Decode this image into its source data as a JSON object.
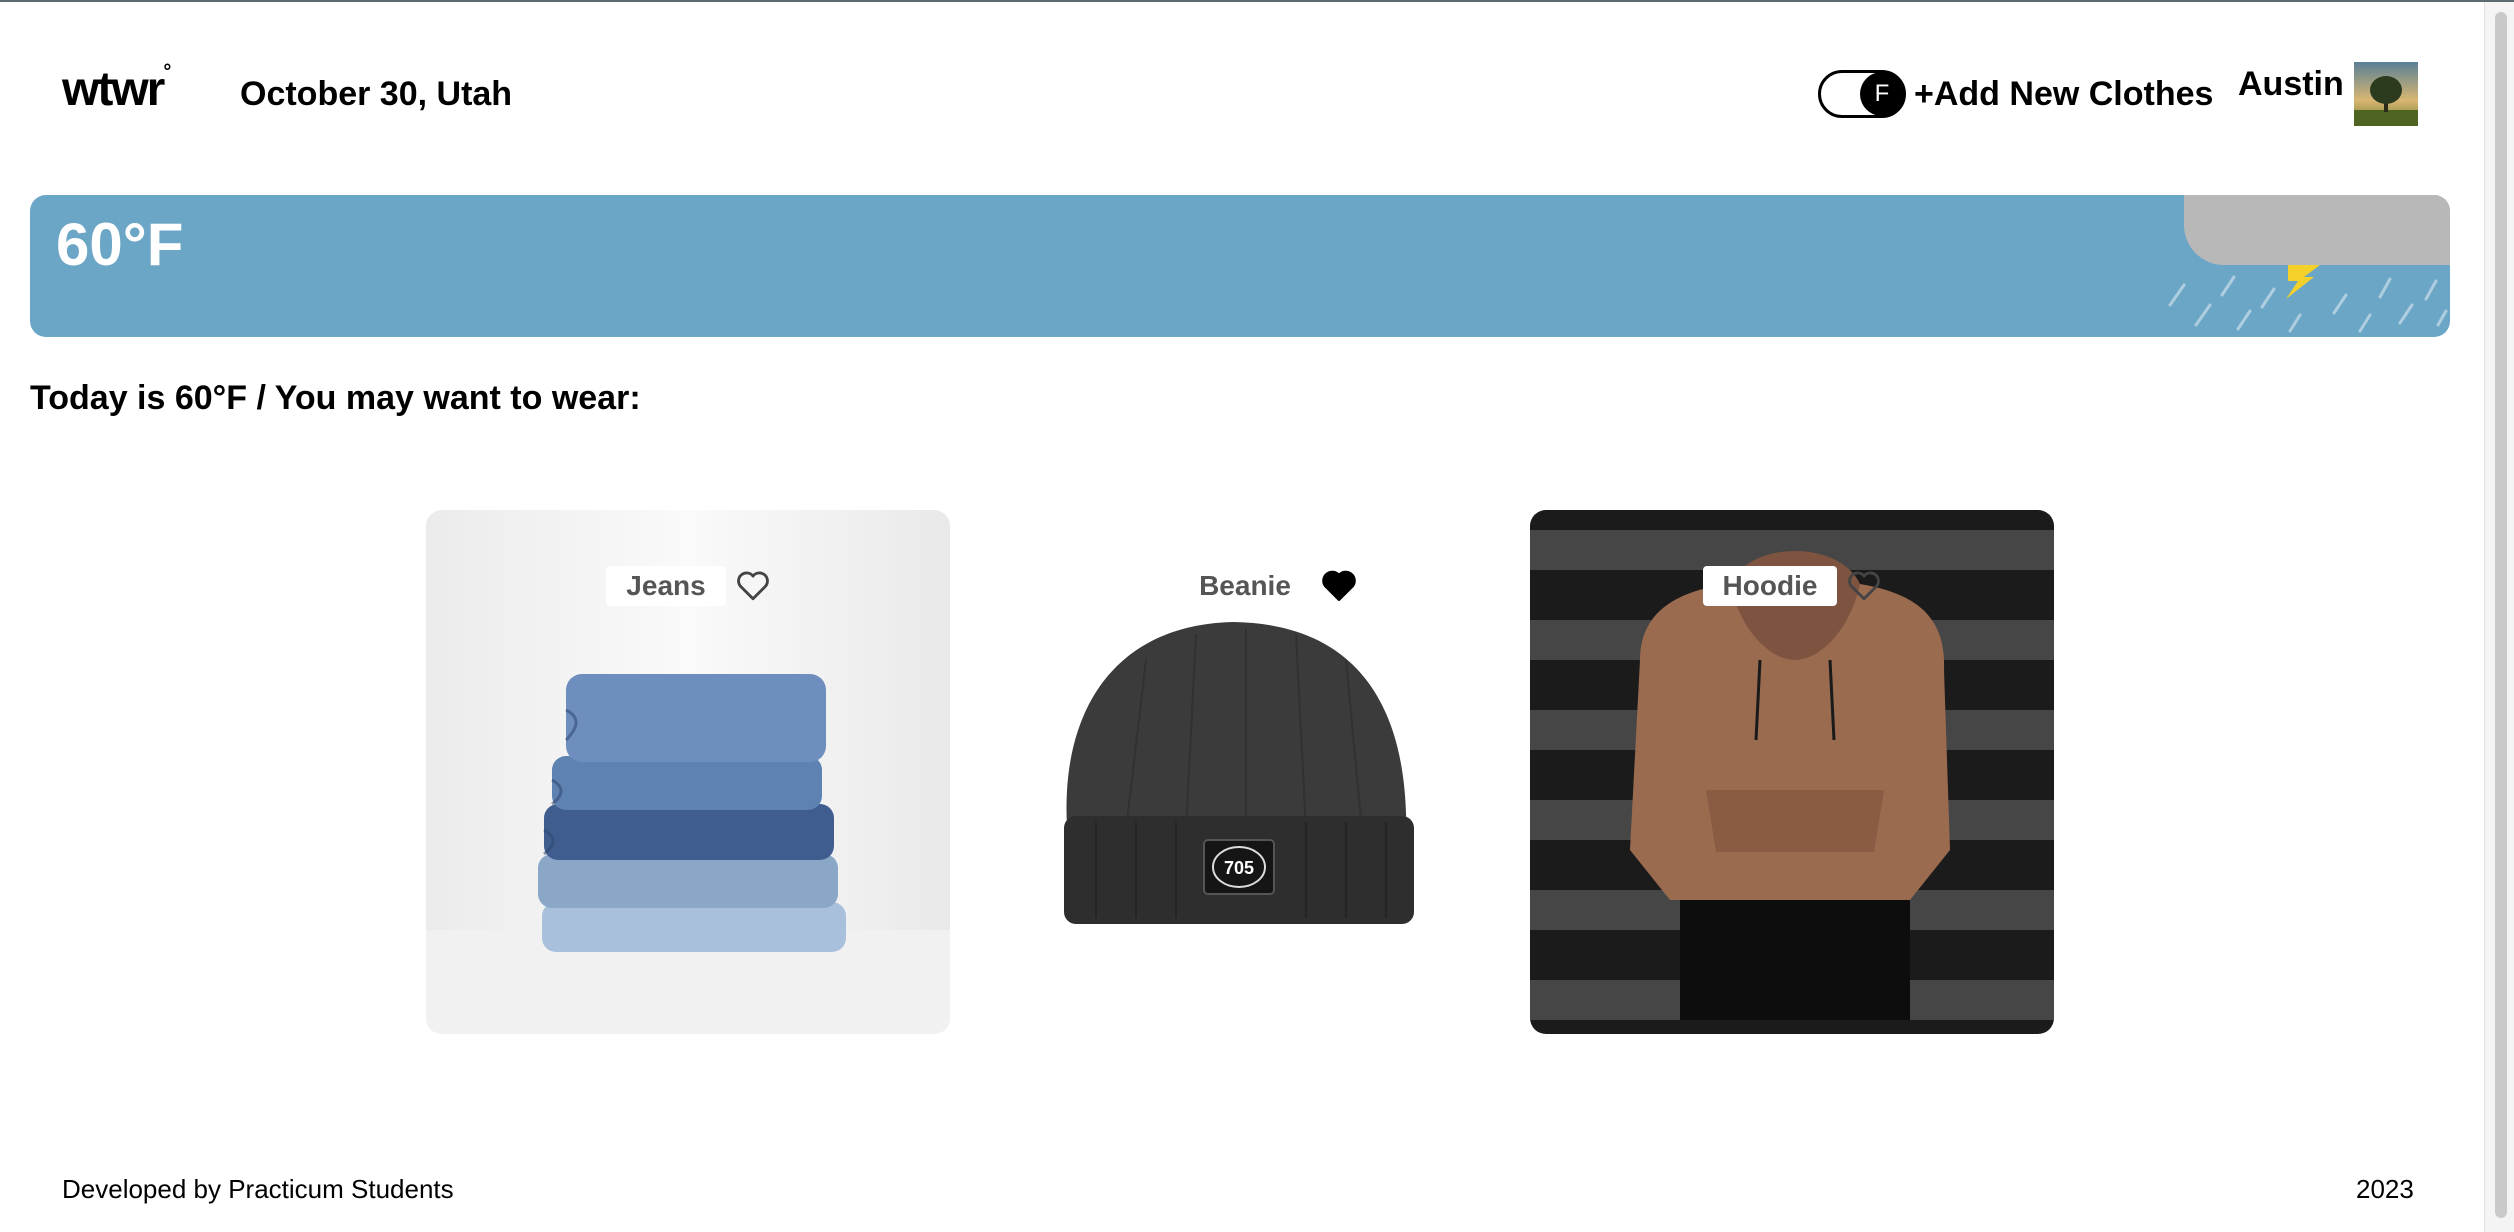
{
  "header": {
    "logo_text": "wtwr",
    "logo_mark": "°",
    "date_location": "October 30, Utah",
    "toggle_label": "F",
    "add_clothes_label": "+Add New Clothes",
    "username": "Austin"
  },
  "weather": {
    "temperature": "60°F",
    "condition_icon": "storm-cloud-icon"
  },
  "suggestion": "Today is 60°F / You may want to wear:",
  "items": [
    {
      "name": "Jeans",
      "liked": false,
      "icon": "heart-outline-icon"
    },
    {
      "name": "Beanie",
      "liked": true,
      "icon": "heart-filled-icon"
    },
    {
      "name": "Hoodie",
      "liked": false,
      "icon": "heart-outline-icon"
    }
  ],
  "footer": {
    "credit": "Developed by Practicum Students",
    "year": "2023"
  },
  "colors": {
    "weather_bar": "#6ca6c6",
    "cloud": "#b8b8b8",
    "bolt": "#f4d02a"
  }
}
